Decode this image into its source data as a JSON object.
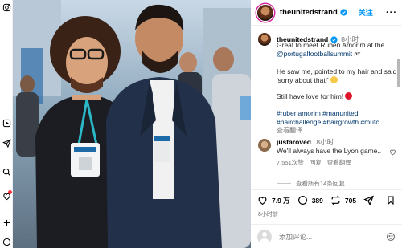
{
  "post": {
    "username": "theunitedstrand",
    "follow_label": "关注",
    "more_label": "···"
  },
  "caption": {
    "username": "theunitedstrand",
    "time": "8小时",
    "line1": "Great to meet Ruben Amorim at the",
    "mention": "@portugalfootballsummit",
    "mention_tag": "PT",
    "line2": "He saw me, pointed to my hair and said 'sorry about that!'",
    "line3": "Still have love for him!",
    "hashtags": "#rubenamorim #manunited #hairchallenge #hairgrowth #mufc",
    "translate": "查看翻译"
  },
  "comment": {
    "username": "justaroved",
    "time": "8小时",
    "text": "We'll always have the Lyon game..",
    "likes": "7,551次赞",
    "reply": "回复",
    "translate": "查看翻译",
    "view_replies": "查看所有14条回复"
  },
  "actions": {
    "likes": "7.9 万",
    "comments": "389",
    "shares": "705",
    "time_ago": "8小时前"
  },
  "add_comment": {
    "placeholder": "添加评论..."
  },
  "colors": {
    "accent": "#0095f6",
    "link": "#00376b",
    "muted": "#737373"
  }
}
